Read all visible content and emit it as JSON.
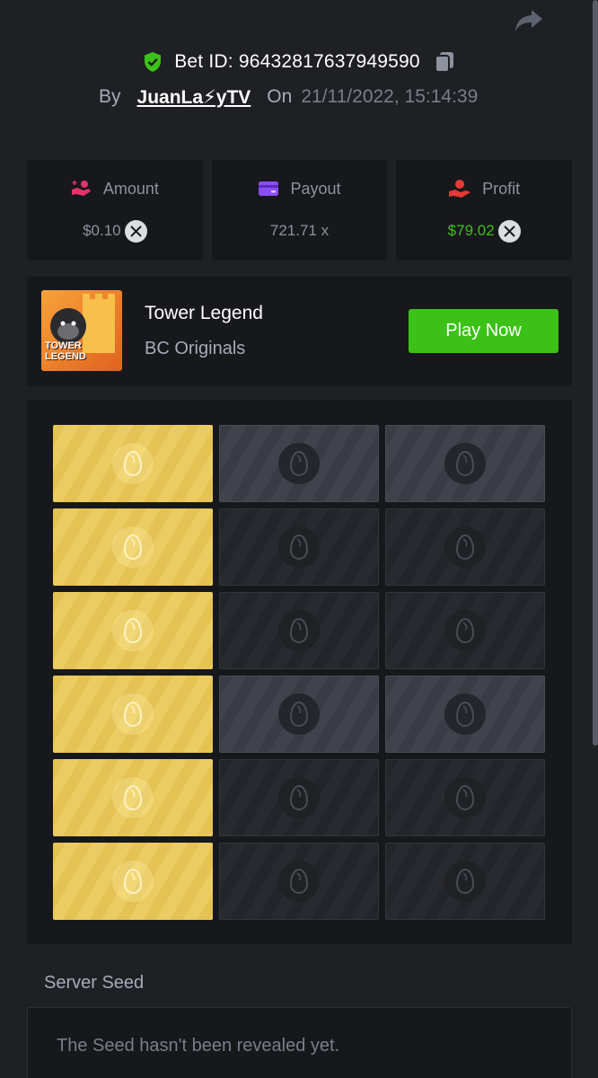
{
  "header": {
    "share_icon": "share-arrow-icon",
    "bet_id_text": "Bet ID: 96432817637949590",
    "verified_icon": "shield-check-icon",
    "copy_icon": "copy-icon",
    "by_label": "By",
    "username": "JuanLa⚡yTV",
    "on_label": "On",
    "datetime": "21/11/2022, 15:14:39"
  },
  "stats": [
    {
      "label": "Amount",
      "value": "$0.10",
      "icon": "hand-coins-icon",
      "icon_color": "#e8326e",
      "value_color": "#8e929e",
      "currency_icon": "xrp-icon"
    },
    {
      "label": "Payout",
      "value": "721.71 x",
      "icon": "card-icon",
      "icon_color": "#8b4ef5",
      "value_color": "#8e929e",
      "currency_icon": ""
    },
    {
      "label": "Profit",
      "value": "$79.02",
      "icon": "profit-hand-icon",
      "icon_color": "#e53935",
      "value_color": "#3bc117",
      "currency_icon": "xrp-icon"
    }
  ],
  "game": {
    "thumbnail_text": "TOWER LEGEND",
    "title": "Tower Legend",
    "provider": "BC Originals",
    "play_label": "Play Now"
  },
  "board": {
    "columns": 3,
    "tile_icon": "egg-icon",
    "rows": [
      [
        "gold",
        "lit",
        "lit"
      ],
      [
        "gold",
        "dim",
        "dim"
      ],
      [
        "gold",
        "dim",
        "dim"
      ],
      [
        "gold",
        "lit",
        "lit"
      ],
      [
        "gold",
        "dim",
        "dim"
      ],
      [
        "gold",
        "dim",
        "dim"
      ]
    ]
  },
  "seed": {
    "label": "Server Seed",
    "text": "The Seed hasn't been revealed yet."
  },
  "colors": {
    "background": "#1f2024",
    "card": "#17181b",
    "accent_green": "#3bc117",
    "tile_gold": "#e8c65a",
    "tile_lit": "#3c3e47",
    "tile_dim": "#26272c"
  }
}
